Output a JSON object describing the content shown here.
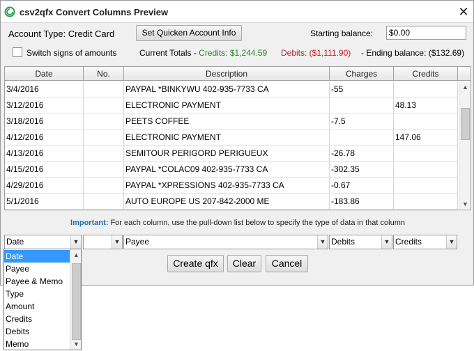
{
  "window": {
    "title": "csv2qfx Convert Columns Preview"
  },
  "account": {
    "type_label": "Account Type: Credit Card",
    "set_info_button": "Set Quicken Account Info",
    "starting_balance_label": "Starting balance:",
    "starting_balance_value": "$0.00",
    "switch_signs_label": "Switch signs of amounts",
    "totals_label": "Current Totals - ",
    "credits_text": "Credits: $1,244.59",
    "debits_text": "Debits: ($1,111.90)",
    "ending_text": "- Ending balance: ($132.69)"
  },
  "table": {
    "headers": [
      "Date",
      "No.",
      "Description",
      "Charges",
      "Credits"
    ],
    "rows": [
      {
        "date": "3/4/2016",
        "no": "",
        "desc": "PAYPAL *BINKYWU 402-935-7733 CA",
        "charges": "-55",
        "credits": ""
      },
      {
        "date": "3/12/2016",
        "no": "",
        "desc": "ELECTRONIC PAYMENT",
        "charges": "",
        "credits": "48.13"
      },
      {
        "date": "3/18/2016",
        "no": "",
        "desc": "PEETS COFFEE",
        "charges": "-7.5",
        "credits": ""
      },
      {
        "date": "4/12/2016",
        "no": "",
        "desc": "ELECTRONIC PAYMENT",
        "charges": "",
        "credits": "147.06"
      },
      {
        "date": "4/13/2016",
        "no": "",
        "desc": "SEMITOUR PERIGORD PERIGUEUX",
        "charges": "-26.78",
        "credits": ""
      },
      {
        "date": "4/15/2016",
        "no": "",
        "desc": "PAYPAL *COLAC09 402-935-7733 CA",
        "charges": "-302.35",
        "credits": ""
      },
      {
        "date": "4/29/2016",
        "no": "",
        "desc": "PAYPAL *XPRESSIONS 402-935-7733 CA",
        "charges": "-0.67",
        "credits": ""
      },
      {
        "date": "5/1/2016",
        "no": "",
        "desc": "AUTO EUROPE US 207-842-2000 ME",
        "charges": "-183.86",
        "credits": ""
      }
    ]
  },
  "important": {
    "prefix": "Important:",
    "text": " For each column, use the pull-down list below to specify the type of data in that column"
  },
  "column_types": {
    "date": "Date",
    "no": "",
    "desc": "Payee",
    "charges": "Debits",
    "credits": "Credits"
  },
  "dropdown": {
    "options": [
      "Date",
      "Payee",
      "Payee & Memo",
      "Type",
      "Amount",
      "Credits",
      "Debits",
      "Memo"
    ],
    "selected": "Date"
  },
  "buttons": {
    "create": "Create qfx",
    "clear": "Clear",
    "cancel": "Cancel"
  }
}
